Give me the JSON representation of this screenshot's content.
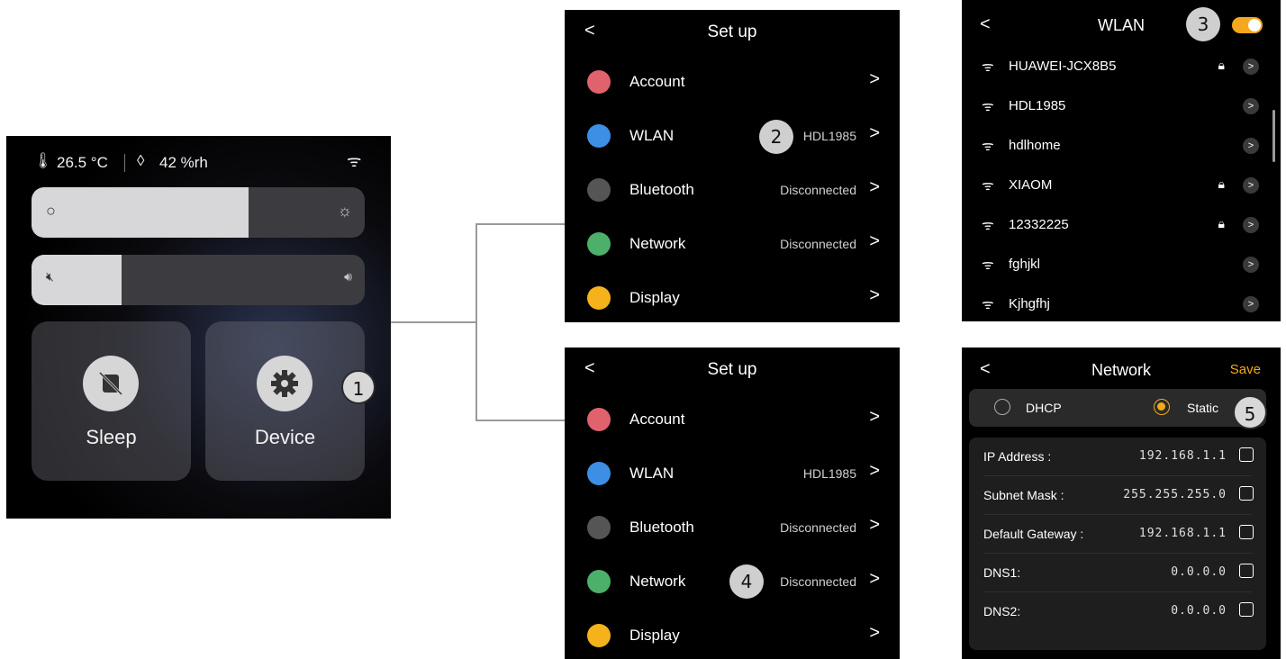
{
  "home": {
    "temperature": "26.5 °C",
    "humidity": "42 %rh",
    "brightness_level": 0.65,
    "volume_level": 0.27,
    "tiles": [
      {
        "label": "Sleep"
      },
      {
        "label": "Device"
      }
    ]
  },
  "badges": [
    "1",
    "2",
    "3",
    "4",
    "5"
  ],
  "setup_top": {
    "back": "<",
    "title": "Set up",
    "items": [
      {
        "label": "Account",
        "value": "",
        "color": "#e0626c"
      },
      {
        "label": "WLAN",
        "value": "HDL1985",
        "color": "#3d8fe6"
      },
      {
        "label": "Bluetooth",
        "value": "Disconnected",
        "color": "#555555"
      },
      {
        "label": "Network",
        "value": "Disconnected",
        "color": "#4caf6a"
      },
      {
        "label": "Display",
        "value": "",
        "color": "#f5b21b"
      }
    ]
  },
  "setup_bottom": {
    "back": "<",
    "title": "Set up",
    "items": [
      {
        "label": "Account",
        "value": "",
        "color": "#e0626c"
      },
      {
        "label": "WLAN",
        "value": "HDL1985",
        "color": "#3d8fe6"
      },
      {
        "label": "Bluetooth",
        "value": "Disconnected",
        "color": "#555555"
      },
      {
        "label": "Network",
        "value": "Disconnected",
        "color": "#4caf6a"
      },
      {
        "label": "Display",
        "value": "",
        "color": "#f5b21b"
      }
    ]
  },
  "wlan": {
    "back": "<",
    "title": "WLAN",
    "toggle_on": true,
    "networks": [
      {
        "name": "HUAWEI-JCX8B5",
        "locked": true
      },
      {
        "name": "HDL1985",
        "locked": false
      },
      {
        "name": "hdlhome",
        "locked": false
      },
      {
        "name": "XIAOM",
        "locked": true
      },
      {
        "name": "12332225",
        "locked": true
      },
      {
        "name": "fghjkl",
        "locked": false
      },
      {
        "name": "Kjhgfhj",
        "locked": false
      }
    ]
  },
  "network": {
    "back": "<",
    "title": "Network",
    "save": "Save",
    "mode_dhcp": "DHCP",
    "mode_static": "Static",
    "selected_mode": "Static",
    "fields": [
      {
        "label": "IP Address :",
        "value": "192.168.1.1"
      },
      {
        "label": "Subnet Mask :",
        "value": "255.255.255.0"
      },
      {
        "label": "Default Gateway :",
        "value": "192.168.1.1"
      },
      {
        "label": "DNS1:",
        "value": "0.0.0.0"
      },
      {
        "label": "DNS2:",
        "value": "0.0.0.0"
      }
    ]
  }
}
